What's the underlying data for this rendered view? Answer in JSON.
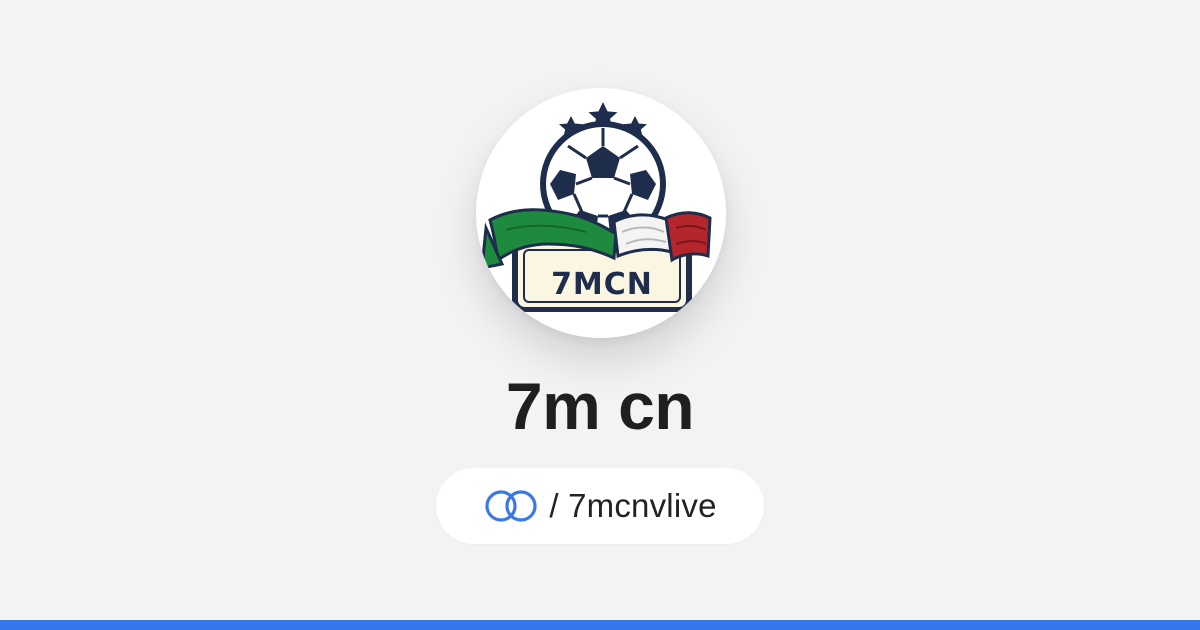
{
  "profile": {
    "logo_text": "7MCN",
    "name": "7m cn",
    "handle": "/ 7mcnvlive",
    "link_icon": "chain-link-icon"
  },
  "colors": {
    "background": "#f3f3f5",
    "accent": "#3777ee",
    "link_icon": "#3b78e7",
    "logo_navy": "#1f2d4d",
    "flag_green": "#1e8a3e",
    "flag_red": "#b5262c",
    "banner_cream": "#fbf6e2"
  }
}
